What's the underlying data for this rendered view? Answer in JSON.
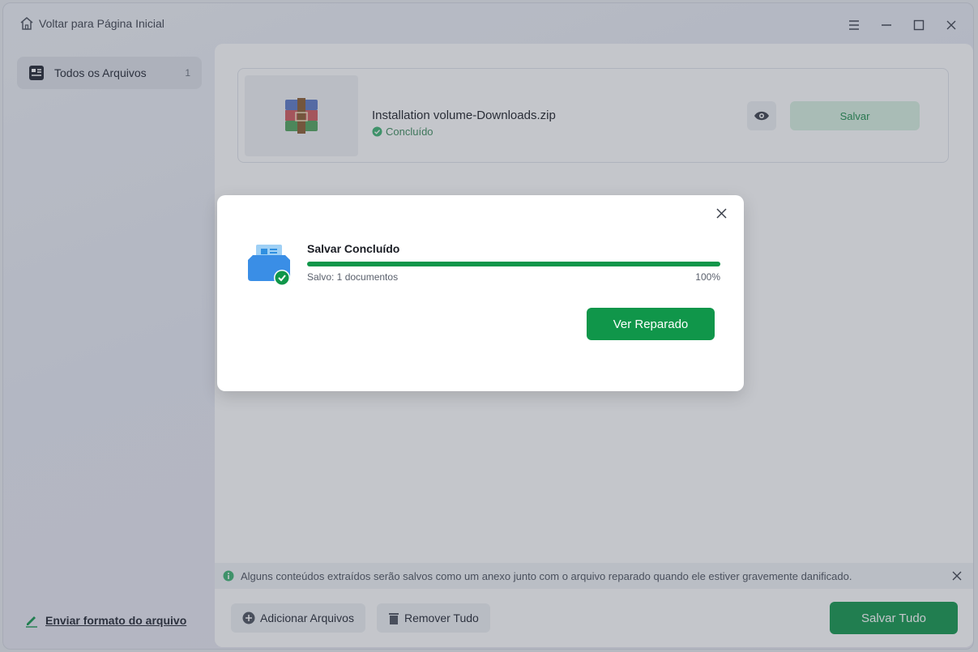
{
  "titlebar": {
    "home_label": "Voltar para Página Inicial"
  },
  "sidebar": {
    "items": [
      {
        "label": "Todos os Arquivos",
        "count": "1",
        "icon": "document-list-icon"
      }
    ],
    "send_format_label": "Enviar formato do arquivo"
  },
  "file": {
    "name": "Installation volume-Downloads.zip",
    "status": "Concluído",
    "save_label": "Salvar",
    "thumb_icon": "winrar-archive-icon"
  },
  "notice": {
    "text": "Alguns conteúdos extraídos serão salvos como um anexo junto com o arquivo reparado quando ele estiver gravemente danificado."
  },
  "footer": {
    "add_label": "Adicionar Arquivos",
    "remove_label": "Remover Tudo",
    "save_all_label": "Salvar Tudo"
  },
  "modal": {
    "title": "Salvar Concluído",
    "saved_text": "Salvo: 1 documentos",
    "percent_text": "100%",
    "progress": 1.0,
    "view_button": "Ver Reparado"
  },
  "colors": {
    "accent_green": "#10964a",
    "light_green": "#d8f0e0"
  }
}
